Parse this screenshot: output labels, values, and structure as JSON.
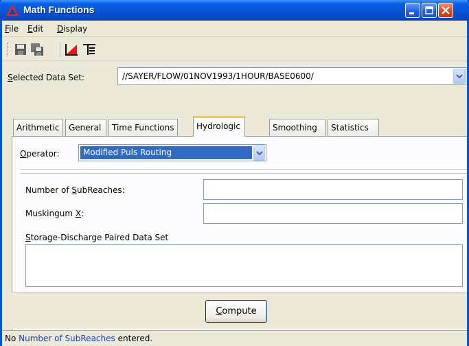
{
  "window": {
    "title": "Math Functions",
    "colors": {
      "titlebar": "#0854d6",
      "close": "#d9451f",
      "selection": "#316ac5",
      "tab_highlight": "#ffc83c"
    }
  },
  "menu": {
    "items": [
      {
        "mnemonic": "F",
        "rest": "ile"
      },
      {
        "mnemonic": "E",
        "rest": "dit"
      },
      {
        "mnemonic": "D",
        "rest": "isplay"
      }
    ]
  },
  "toolbar": {
    "icons": [
      "save-icon",
      "save-as-icon",
      "plot-icon",
      "tabulate-icon"
    ]
  },
  "data_set": {
    "label_mnemonic": "S",
    "label_rest": "elected Data Set:",
    "value": "//SAYER/FLOW/01NOV1993/1HOUR/BASE0600/"
  },
  "tabs": [
    {
      "label": "Arithmetic",
      "active": false
    },
    {
      "label": "General",
      "active": false
    },
    {
      "label": "Time Functions",
      "active": false
    },
    {
      "label": "Hydrologic",
      "active": true
    },
    {
      "label": "Smoothing",
      "active": false
    },
    {
      "label": "Statistics",
      "active": false
    }
  ],
  "operator": {
    "label_mnemonic": "O",
    "label_rest": "perator:",
    "value": "Modified Puls Routing"
  },
  "fields": {
    "subreaches": {
      "label_before": "Number of ",
      "label_mnemonic": "S",
      "label_after": "ubReaches:",
      "value": ""
    },
    "muskingum": {
      "label_before": "Muskingum ",
      "label_mnemonic": "X",
      "label_after": ":",
      "value": ""
    },
    "storage": {
      "label_before": "",
      "label_mnemonic": "S",
      "label_after": "torage-Discharge Paired Data Set",
      "value": ""
    }
  },
  "compute": {
    "mnemonic": "C",
    "rest": "ompute"
  },
  "status": {
    "prefix": "No ",
    "link": "Number of SubReaches",
    "suffix": " entered."
  }
}
